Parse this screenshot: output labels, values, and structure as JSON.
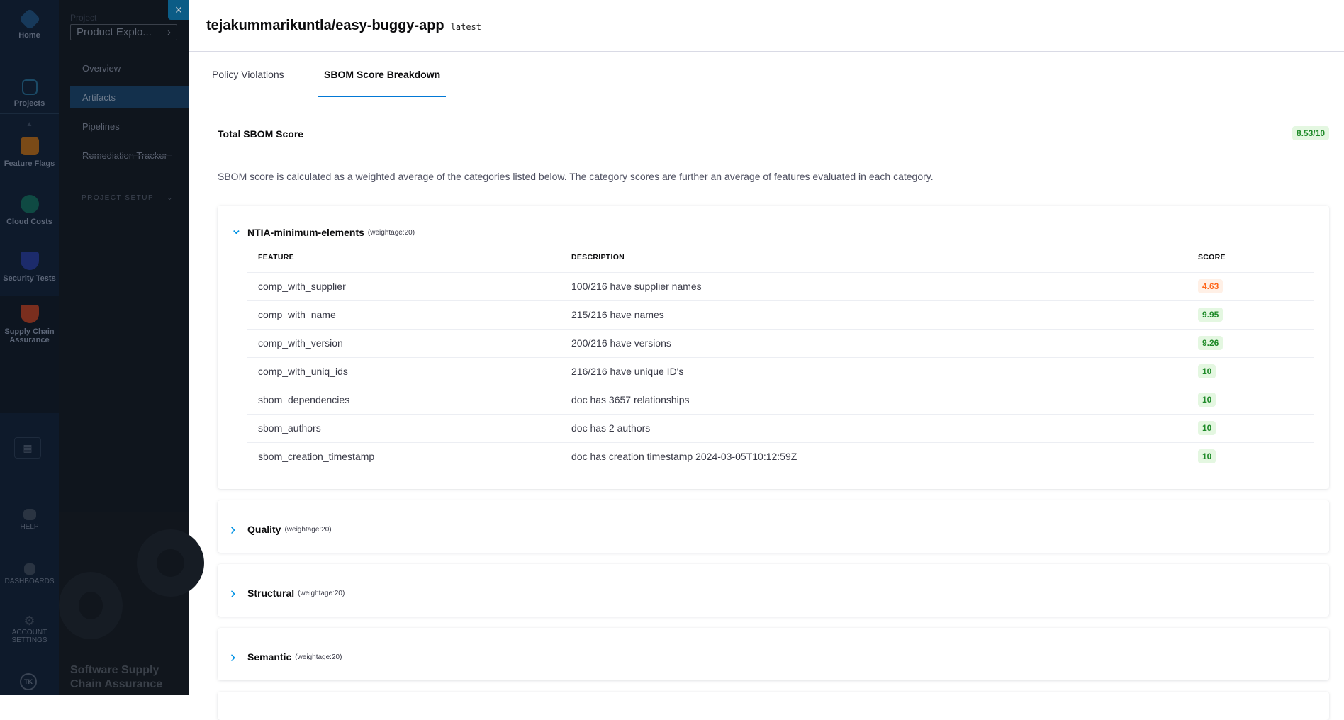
{
  "nav": {
    "items": [
      {
        "label": "Home",
        "icon": "home-icon"
      },
      {
        "label": "Projects",
        "icon": "projects-icon"
      },
      {
        "label": "Feature Flags",
        "icon": "feature-flags-icon"
      },
      {
        "label": "Cloud Costs",
        "icon": "cloud-costs-icon"
      },
      {
        "label": "Security Tests",
        "icon": "security-tests-icon"
      },
      {
        "label": "Supply Chain Assurance",
        "icon": "supply-chain-icon"
      }
    ],
    "bottom": [
      {
        "label": "HELP"
      },
      {
        "label": "DASHBOARDS"
      },
      {
        "label": "ACCOUNT SETTINGS"
      }
    ],
    "avatar": "TK"
  },
  "subnav": {
    "project_label": "Project",
    "project_value": "Product Explo...",
    "items": [
      "Overview",
      "Artifacts",
      "Pipelines",
      "Remediation Tracker"
    ],
    "active": "Artifacts",
    "section": "PROJECT SETUP",
    "module_title": "Software Supply Chain Assurance"
  },
  "close_label": "×",
  "header": {
    "title": "tejakummarikuntla/easy-buggy-app",
    "tag": "latest"
  },
  "tabs": [
    {
      "label": "Policy Violations"
    },
    {
      "label": "SBOM Score Breakdown",
      "active": true
    }
  ],
  "total": {
    "label": "Total SBOM Score",
    "value": "8.53/10"
  },
  "description": "SBOM score is calculated as a weighted average of the categories listed below. The category scores are further an average of features evaluated in each category.",
  "colors": {
    "accent": "#0278d5",
    "good": "#1e8a28",
    "warn": "#ff661a"
  },
  "categories": [
    {
      "name": "NTIA-minimum-elements",
      "weight": "(weightage:20)",
      "expanded": true,
      "columns": [
        "FEATURE",
        "DESCRIPTION",
        "SCORE"
      ],
      "rows": [
        {
          "feature": "comp_with_supplier",
          "description": "100/216 have supplier names",
          "score": "4.63",
          "status": "warn"
        },
        {
          "feature": "comp_with_name",
          "description": "215/216 have names",
          "score": "9.95",
          "status": "good"
        },
        {
          "feature": "comp_with_version",
          "description": "200/216 have versions",
          "score": "9.26",
          "status": "good"
        },
        {
          "feature": "comp_with_uniq_ids",
          "description": "216/216 have unique ID's",
          "score": "10",
          "status": "good"
        },
        {
          "feature": "sbom_dependencies",
          "description": "doc has 3657 relationships",
          "score": "10",
          "status": "good"
        },
        {
          "feature": "sbom_authors",
          "description": "doc has 2 authors",
          "score": "10",
          "status": "good"
        },
        {
          "feature": "sbom_creation_timestamp",
          "description": "doc has creation timestamp 2024-03-05T10:12:59Z",
          "score": "10",
          "status": "good"
        }
      ]
    },
    {
      "name": "Quality",
      "weight": "(weightage:20)",
      "expanded": false
    },
    {
      "name": "Structural",
      "weight": "(weightage:20)",
      "expanded": false
    },
    {
      "name": "Semantic",
      "weight": "(weightage:20)",
      "expanded": false
    }
  ]
}
